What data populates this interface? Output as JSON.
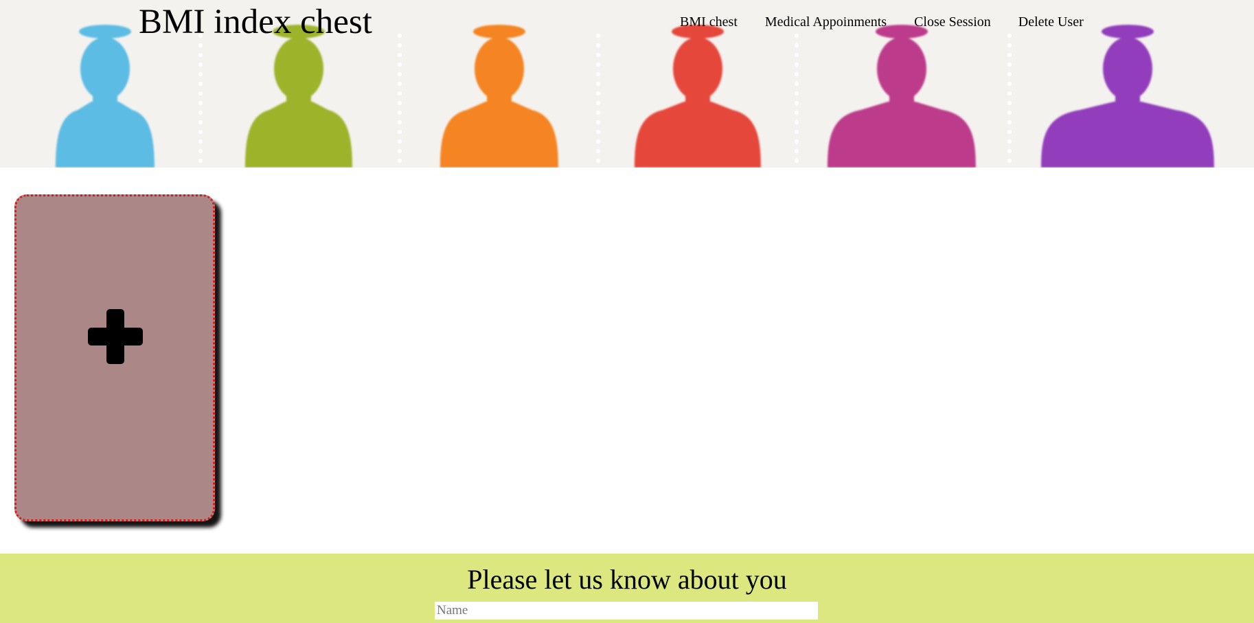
{
  "header": {
    "title": "BMI index chest",
    "banner_colors": [
      "#5bbce3",
      "#9cb32a",
      "#f58423",
      "#e5473a",
      "#bd3a8b",
      "#923cbc"
    ]
  },
  "nav": {
    "items": [
      {
        "label": "BMI chest"
      },
      {
        "label": "Medical Appoinments"
      },
      {
        "label": "Close Session"
      },
      {
        "label": "Delete User"
      }
    ]
  },
  "main": {
    "add_card": {
      "icon": "plus-icon",
      "color": "#ab8887",
      "border_color": "#e01818"
    }
  },
  "footer": {
    "title": "Please let us know about you",
    "name_placeholder": "Name",
    "name_value": "",
    "color": "#dce780"
  }
}
